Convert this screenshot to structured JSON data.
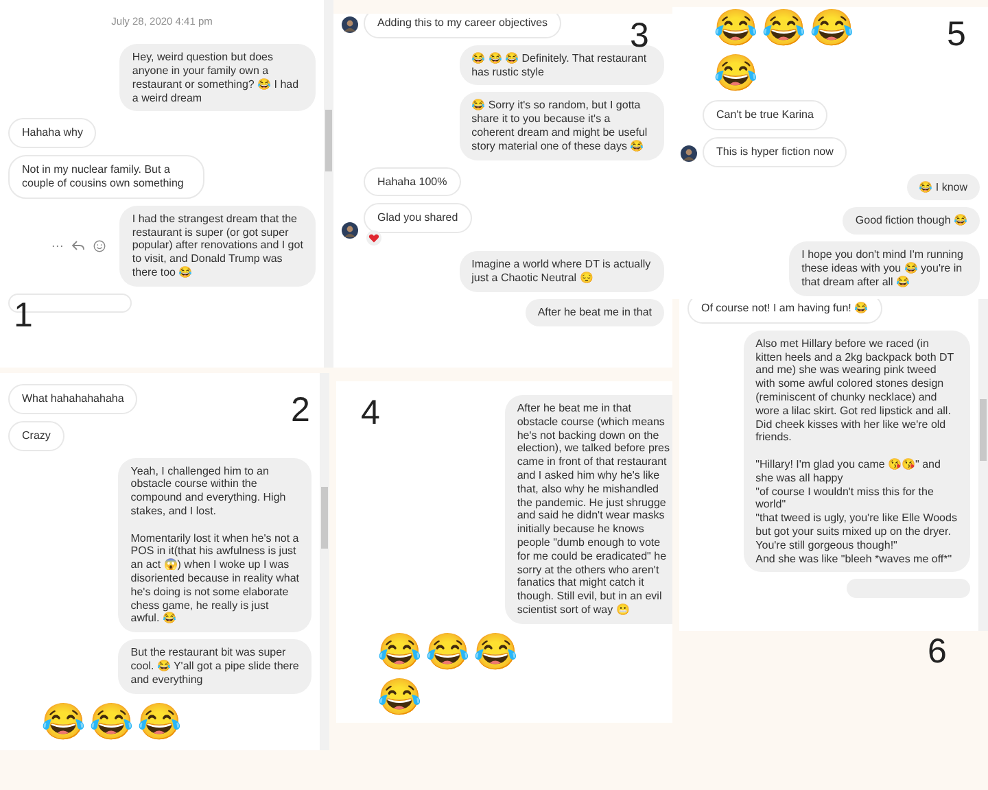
{
  "panels": [
    {
      "label": "1",
      "scrollbar": true,
      "timestamp": "July 28, 2020 4:41 pm",
      "messages": [
        {
          "kind": "bubble",
          "outgoing": true,
          "text": "Hey, weird question but does anyone in your family own a restaurant or something? 😂 I had a weird dream"
        },
        {
          "kind": "bubble",
          "outgoing": false,
          "text": "Hahaha why"
        },
        {
          "kind": "bubble",
          "outgoing": false,
          "text": "Not in my nuclear family. But a couple of cousins own something"
        },
        {
          "kind": "bubble",
          "outgoing": true,
          "actions": {
            "more": "···"
          },
          "text": "I had the strangest dream that the restaurant is super (or got super popular) after renovations and I got to visit, and Donald Trump was there too 😂"
        },
        {
          "kind": "partial",
          "outgoing": false
        }
      ]
    },
    {
      "label": "2",
      "scrollbar": true,
      "messages": [
        {
          "kind": "bubble",
          "outgoing": false,
          "text": "What hahahahahaha"
        },
        {
          "kind": "bubble",
          "outgoing": false,
          "text": "Crazy"
        },
        {
          "kind": "bubble",
          "outgoing": true,
          "text": "Yeah, I challenged him to an obstacle course within the compound and everything. High stakes, and I lost.\n\nMomentarily lost it when he's not a POS in it(that his awfulness is just an act 😱) when I woke up I was disoriented because in reality what he's doing is not some elaborate chess game, he really is just awful. 😂"
        },
        {
          "kind": "bubble",
          "outgoing": true,
          "text": "But the restaurant bit was super cool. 😂 Y'all got a pipe slide there and everything"
        },
        {
          "kind": "jumbo",
          "emojis": [
            "😂",
            "😂",
            "😂"
          ]
        }
      ]
    },
    {
      "label": "3",
      "messages": [
        {
          "kind": "bubble",
          "outgoing": false,
          "avatar": true,
          "text": "Adding this to my career objectives"
        },
        {
          "kind": "bubble",
          "outgoing": true,
          "text": "😂 😂 😂 Definitely. That restaurant has rustic style"
        },
        {
          "kind": "bubble",
          "outgoing": true,
          "text": "😂 Sorry it's so random, but I gotta share it to you because it's a coherent dream and might be useful story material one of these days 😂"
        },
        {
          "kind": "bubble",
          "outgoing": false,
          "text": "Hahaha 100%"
        },
        {
          "kind": "bubble",
          "outgoing": false,
          "avatar": true,
          "reacted": true,
          "text": "Glad you shared"
        },
        {
          "kind": "bubble",
          "outgoing": true,
          "text": "Imagine a world where DT is actually just a Chaotic Neutral 😔"
        },
        {
          "kind": "bubble",
          "outgoing": true,
          "text": "After he beat me in that"
        }
      ]
    },
    {
      "label": "4",
      "messages": [
        {
          "kind": "bubble",
          "outgoing": true,
          "text": "After he beat me in that\nobstacle course (which means\nhe's not backing down on the\nelection), we talked before pres\ncame in front of that restaurant\nand I asked him why he's like\nthat, also why he mishandled\nthe pandemic. He just shrugge\nand said he didn't wear masks\ninitially because he knows\npeople \"dumb enough to vote\nfor me could be eradicated\" he\nsorry at the others who aren't\nfanatics that might catch it\nthough. Still evil, but in an evil\nscientist sort of way 😬"
        },
        {
          "kind": "jumbo",
          "emojis": [
            "😂",
            "😂",
            "😂",
            "😂"
          ]
        }
      ]
    },
    {
      "label": "5",
      "messages": [
        {
          "kind": "jumbo",
          "emojis": [
            "😂",
            "😂",
            "😂",
            "😂"
          ]
        },
        {
          "kind": "bubble",
          "outgoing": false,
          "text": "Can't be true Karina"
        },
        {
          "kind": "bubble",
          "outgoing": false,
          "avatar": true,
          "text": "This is hyper fiction now"
        },
        {
          "kind": "bubble",
          "outgoing": true,
          "text": "😂 I know"
        },
        {
          "kind": "bubble",
          "outgoing": true,
          "text": "Good fiction though 😂"
        },
        {
          "kind": "bubble",
          "outgoing": true,
          "text": "I hope you don't mind I'm running these ideas with you 😂 you're in that dream after all 😂"
        }
      ]
    },
    {
      "label": "6",
      "scrollbar": true,
      "messages": [
        {
          "kind": "bubble",
          "outgoing": false,
          "text": "Of course not! I am having fun! 😂"
        },
        {
          "kind": "bubble",
          "outgoing": true,
          "text": "Also met Hillary before we raced (in kitten heels and a 2kg backpack both DT and me) she was wearing pink tweed with some awful colored stones design (reminiscent of chunky necklace) and wore a lilac skirt. Got red lipstick and all. Did cheek kisses with her like we're old friends.\n\n\"Hillary! I'm glad you came 😘😘\" and she was all happy\n\"of course I wouldn't miss this for the world\"\n\"that tweed is ugly, you're like Elle Woods but got your suits mixed up on the dryer. You're still gorgeous though!\"\nAnd she was like \"bleeh *waves me off*\""
        },
        {
          "kind": "partial",
          "outgoing": true
        }
      ]
    }
  ]
}
